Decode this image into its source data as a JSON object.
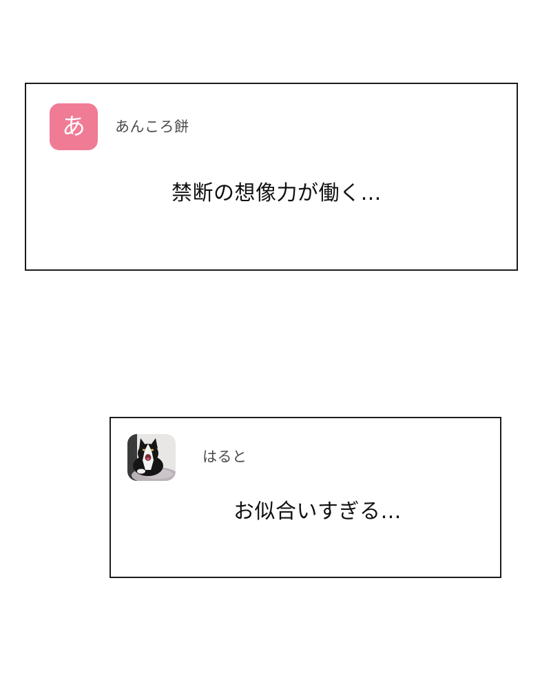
{
  "comments": [
    {
      "avatar_letter": "あ",
      "avatar_color": "#f07b95",
      "username": "あんころ餅",
      "message": "禁断の想像力が働く…"
    },
    {
      "avatar_icon": "cat-photo-icon",
      "username": "はると",
      "message": "お似合いすぎる…"
    }
  ]
}
